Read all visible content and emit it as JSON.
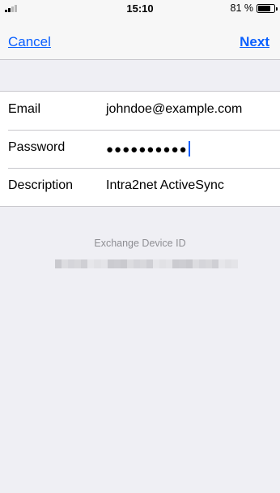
{
  "status_bar": {
    "time": "15:10",
    "battery_percent": "81 %",
    "battery_level": 0.81,
    "signal_bars_active": 2,
    "signal_bars_total": 4
  },
  "nav": {
    "cancel_label": "Cancel",
    "next_label": "Next",
    "link_color": "#0a60ff"
  },
  "form": {
    "rows": [
      {
        "label": "Email",
        "value": "johndoe@example.com"
      },
      {
        "label": "Password",
        "value": "●●●●●●●●●●"
      },
      {
        "label": "Description",
        "value": "Intra2net ActiveSync"
      }
    ]
  },
  "exchange": {
    "title": "Exchange Device ID"
  }
}
